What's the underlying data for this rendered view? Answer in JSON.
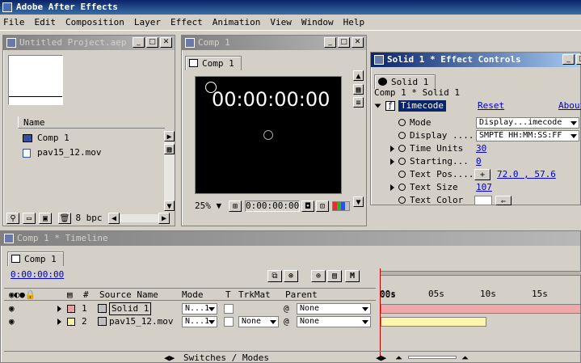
{
  "app": {
    "title": "Adobe After Effects"
  },
  "menu": [
    "File",
    "Edit",
    "Composition",
    "Layer",
    "Effect",
    "Animation",
    "View",
    "Window",
    "Help"
  ],
  "project": {
    "title": "Untitled Project.aep",
    "col_name": "Name",
    "items": [
      {
        "label": "Comp 1",
        "icon": "composition-icon"
      },
      {
        "label": "pav15_12.mov",
        "icon": "footage-icon"
      }
    ],
    "bpc": "8 bpc"
  },
  "comp_window": {
    "title": "Comp 1",
    "tab": "Comp 1",
    "timecode": "00:00:00:00",
    "zoom": "25%",
    "time_readout": "0:00:00:00"
  },
  "effect_controls": {
    "title": "Solid 1 * Effect Controls",
    "tab": "Solid 1",
    "breadcrumb": "Comp 1 * Solid 1",
    "effect_name": "Timecode",
    "reset": "Reset",
    "about": "About...",
    "params": [
      {
        "label": "Mode",
        "value": "Display...imecode",
        "kind": "dropdown",
        "expandable": false
      },
      {
        "label": "Display ....",
        "value": "SMPTE HH:MM:SS:FF",
        "kind": "dropdown",
        "expandable": false
      },
      {
        "label": "Time Units",
        "value": "30",
        "kind": "value",
        "expandable": true
      },
      {
        "label": "Starting...",
        "value": "0",
        "kind": "value",
        "expandable": true
      },
      {
        "label": "Text Pos....",
        "value": "72.0 , 57.6",
        "kind": "point",
        "expandable": false
      },
      {
        "label": "Text Size",
        "value": "107",
        "kind": "value",
        "expandable": true
      },
      {
        "label": "Text Color",
        "value": "",
        "kind": "color",
        "expandable": false
      }
    ]
  },
  "timeline": {
    "title": "Comp 1 * Timeline",
    "tab": "Comp 1",
    "time": "0:00:00:00",
    "headers": {
      "num": "#",
      "source": "Source Name",
      "mode": "Mode",
      "t": "T",
      "trkmat": "TrkMat",
      "parent": "Parent"
    },
    "rulers": [
      "00s",
      "05s",
      "10s",
      "15s"
    ],
    "layers": [
      {
        "num": "1",
        "name": "Solid 1",
        "mode": "N...1",
        "trkmat": "",
        "parent": "None",
        "label_color": "#e8a0a0",
        "bar_color": "#f0a8a8",
        "bar_fraction": 1.0
      },
      {
        "num": "2",
        "name": "pav15_12.mov",
        "mode": "N...1",
        "trkmat": "None",
        "parent": "None",
        "label_color": "#f8f0a0",
        "bar_color": "#fdf5b0",
        "bar_fraction": 0.53
      }
    ],
    "switches_label": "Switches / Modes"
  }
}
